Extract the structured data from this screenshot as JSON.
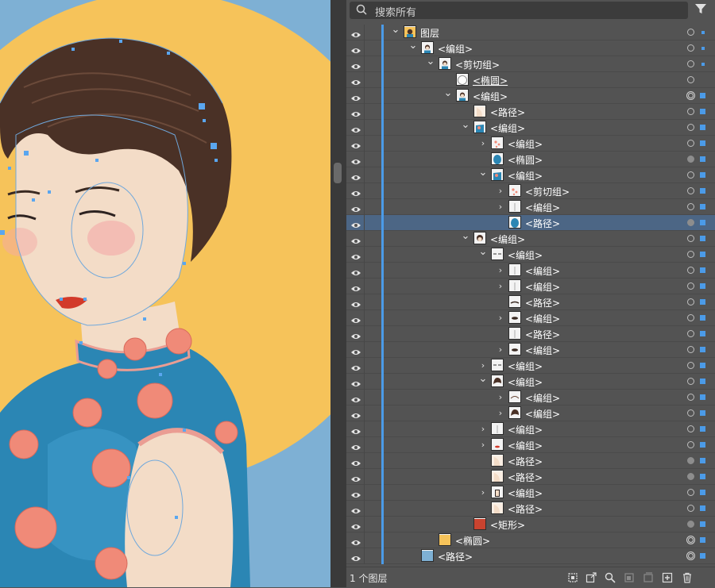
{
  "search": {
    "placeholder": "搜索所有"
  },
  "layers": [
    {
      "label": "图层",
      "indent": 0,
      "caret": "down",
      "thumb": "layer",
      "target": "hollow",
      "sel": "small",
      "underline": false,
      "selected": false
    },
    {
      "label": "<编组>",
      "indent": 1,
      "caret": "down",
      "thumb": "woman",
      "target": "hollow",
      "sel": "small",
      "underline": false,
      "selected": false
    },
    {
      "label": "<剪切组>",
      "indent": 2,
      "caret": "down",
      "thumb": "woman",
      "target": "hollow",
      "sel": "small",
      "underline": false,
      "selected": false
    },
    {
      "label": "<椭圆>",
      "indent": 3,
      "caret": "none",
      "thumb": "circle",
      "target": "hollow",
      "sel": "none",
      "underline": true,
      "selected": false
    },
    {
      "label": "<编组>",
      "indent": 3,
      "caret": "down",
      "thumb": "woman",
      "target": "double",
      "sel": "square",
      "underline": false,
      "selected": false
    },
    {
      "label": "<路径>",
      "indent": 4,
      "caret": "none",
      "thumb": "skin",
      "target": "hollow",
      "sel": "square",
      "underline": false,
      "selected": false
    },
    {
      "label": "<编组>",
      "indent": 4,
      "caret": "down",
      "thumb": "dress",
      "target": "hollow",
      "sel": "square",
      "underline": false,
      "selected": false
    },
    {
      "label": "<编组>",
      "indent": 5,
      "caret": "right",
      "thumb": "flower",
      "target": "hollow",
      "sel": "square",
      "underline": false,
      "selected": false
    },
    {
      "label": "<椭圆>",
      "indent": 5,
      "caret": "none",
      "thumb": "blueoval",
      "target": "filled",
      "sel": "square",
      "underline": false,
      "selected": false
    },
    {
      "label": "<编组>",
      "indent": 5,
      "caret": "down",
      "thumb": "dress",
      "target": "hollow",
      "sel": "square",
      "underline": false,
      "selected": false
    },
    {
      "label": "<剪切组>",
      "indent": 6,
      "caret": "right",
      "thumb": "flower",
      "target": "hollow",
      "sel": "square",
      "underline": false,
      "selected": false
    },
    {
      "label": "<编组>",
      "indent": 6,
      "caret": "right",
      "thumb": "line",
      "target": "hollow",
      "sel": "square",
      "underline": false,
      "selected": false
    },
    {
      "label": "<路径>",
      "indent": 6,
      "caret": "none",
      "thumb": "blueoval",
      "target": "filled",
      "sel": "square",
      "underline": false,
      "selected": true
    },
    {
      "label": "<编组>",
      "indent": 4,
      "caret": "down",
      "thumb": "face",
      "target": "hollow",
      "sel": "square",
      "underline": false,
      "selected": false
    },
    {
      "label": "<编组>",
      "indent": 5,
      "caret": "down",
      "thumb": "eyes",
      "target": "hollow",
      "sel": "square",
      "underline": false,
      "selected": false
    },
    {
      "label": "<编组>",
      "indent": 6,
      "caret": "right",
      "thumb": "line",
      "target": "hollow",
      "sel": "square",
      "underline": false,
      "selected": false
    },
    {
      "label": "<编组>",
      "indent": 6,
      "caret": "right",
      "thumb": "line",
      "target": "hollow",
      "sel": "square",
      "underline": false,
      "selected": false
    },
    {
      "label": "<路径>",
      "indent": 6,
      "caret": "none",
      "thumb": "brow",
      "target": "hollow",
      "sel": "square",
      "underline": false,
      "selected": false
    },
    {
      "label": "<编组>",
      "indent": 6,
      "caret": "right",
      "thumb": "eye",
      "target": "hollow",
      "sel": "square",
      "underline": false,
      "selected": false
    },
    {
      "label": "<路径>",
      "indent": 6,
      "caret": "none",
      "thumb": "line",
      "target": "hollow",
      "sel": "square",
      "underline": false,
      "selected": false
    },
    {
      "label": "<编组>",
      "indent": 6,
      "caret": "right",
      "thumb": "eye",
      "target": "hollow",
      "sel": "square",
      "underline": false,
      "selected": false
    },
    {
      "label": "<编组>",
      "indent": 5,
      "caret": "right",
      "thumb": "eyes",
      "target": "hollow",
      "sel": "square",
      "underline": false,
      "selected": false
    },
    {
      "label": "<编组>",
      "indent": 5,
      "caret": "down",
      "thumb": "hair",
      "target": "hollow",
      "sel": "square",
      "underline": false,
      "selected": false
    },
    {
      "label": "<编组>",
      "indent": 6,
      "caret": "right",
      "thumb": "hairline",
      "target": "hollow",
      "sel": "square",
      "underline": false,
      "selected": false
    },
    {
      "label": "<编组>",
      "indent": 6,
      "caret": "right",
      "thumb": "hair",
      "target": "hollow",
      "sel": "square",
      "underline": false,
      "selected": false
    },
    {
      "label": "<编组>",
      "indent": 5,
      "caret": "right",
      "thumb": "line",
      "target": "hollow",
      "sel": "square",
      "underline": false,
      "selected": false
    },
    {
      "label": "<编组>",
      "indent": 5,
      "caret": "right",
      "thumb": "lips",
      "target": "hollow",
      "sel": "square",
      "underline": false,
      "selected": false
    },
    {
      "label": "<路径>",
      "indent": 5,
      "caret": "none",
      "thumb": "skin",
      "target": "filled",
      "sel": "square",
      "underline": false,
      "selected": false
    },
    {
      "label": "<路径>",
      "indent": 5,
      "caret": "none",
      "thumb": "skin",
      "target": "filled",
      "sel": "square",
      "underline": false,
      "selected": false
    },
    {
      "label": "<编组>",
      "indent": 5,
      "caret": "right",
      "thumb": "hand",
      "target": "hollow",
      "sel": "square",
      "underline": false,
      "selected": false
    },
    {
      "label": "<路径>",
      "indent": 5,
      "caret": "none",
      "thumb": "skin",
      "target": "hollow",
      "sel": "square",
      "underline": false,
      "selected": false
    },
    {
      "label": "<矩形>",
      "indent": 4,
      "caret": "none",
      "thumb": "red",
      "target": "filled",
      "sel": "square",
      "underline": false,
      "selected": false
    },
    {
      "label": "<椭圆>",
      "indent": 2,
      "caret": "none",
      "thumb": "yellow",
      "target": "double",
      "sel": "square",
      "underline": false,
      "selected": false
    },
    {
      "label": "<路径>",
      "indent": 1,
      "caret": "none",
      "thumb": "bluebg",
      "target": "double",
      "sel": "square",
      "underline": false,
      "selected": false
    }
  ],
  "footer": {
    "count": "1 个图层"
  },
  "colors": {
    "accent": "#4b9be8",
    "panel": "#535353",
    "selected_row": "#4c6685",
    "bg_yellow": "#f6c35a",
    "bg_blue": "#7eb0d4",
    "dress": "#2b86b4",
    "flower": "#f08a78"
  }
}
